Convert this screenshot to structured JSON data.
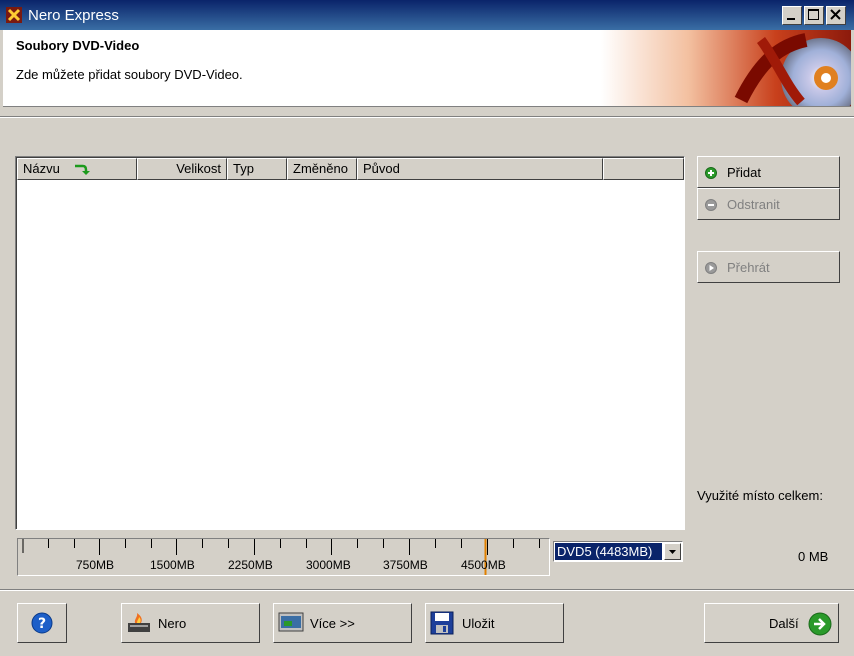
{
  "window": {
    "title": "Nero Express"
  },
  "header": {
    "title": "Soubory DVD-Video",
    "subtitle": "Zde můžete přidat soubory DVD-Video."
  },
  "list": {
    "columns": [
      "Názvu",
      "Velikost",
      "Typ",
      "Změněno",
      "Původ"
    ],
    "rows": []
  },
  "side_buttons": {
    "add_label": "Přidat",
    "remove_label": "Odstranit",
    "play_label": "Přehrát"
  },
  "usage": {
    "label": "Využité místo celkem:",
    "value": "0 MB"
  },
  "ruler": {
    "labels": [
      "750MB",
      "1500MB",
      "2250MB",
      "3000MB",
      "3750MB",
      "4500MB"
    ]
  },
  "disc_select": {
    "selected": "DVD5 (4483MB)"
  },
  "bottom": {
    "nero_label": "Nero",
    "more_label": "Více >>",
    "save_label": "Uložit",
    "next_label": "Další"
  },
  "colors": {
    "titlebar": "#0a246a",
    "selection": "#0a246a",
    "ruler_marker": "#e08000"
  }
}
